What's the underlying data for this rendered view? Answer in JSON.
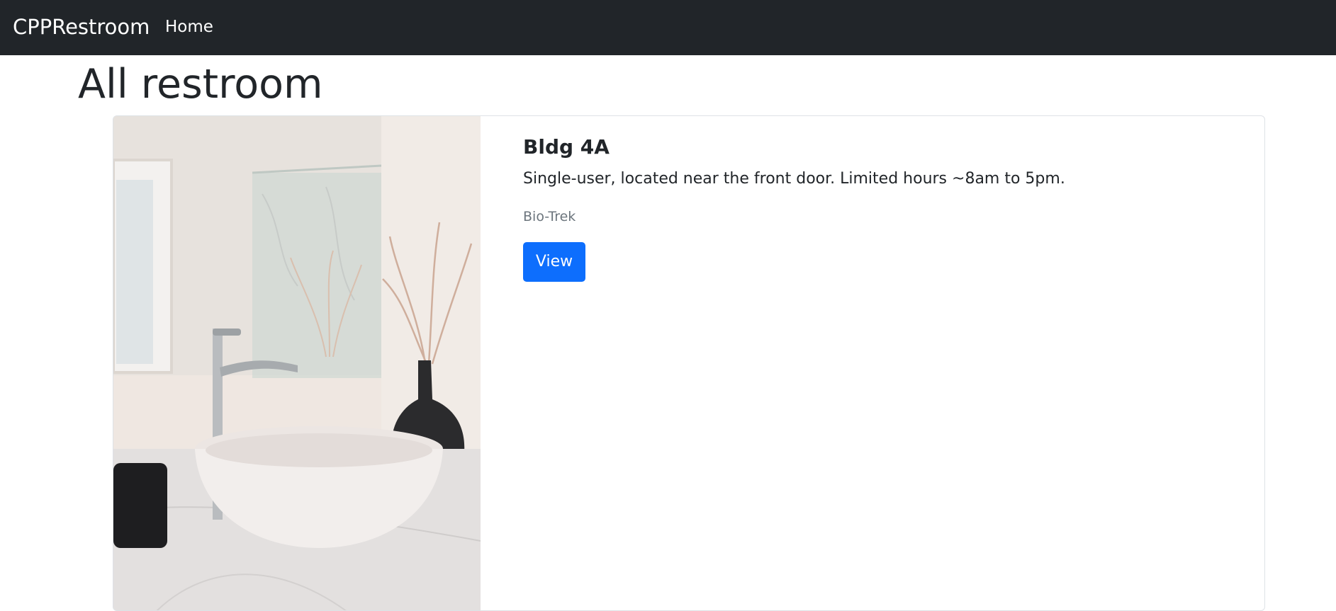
{
  "navbar": {
    "brand": "CPPRestroom",
    "home_label": "Home",
    "background_color": "#212529"
  },
  "main": {
    "title": "All restroom",
    "restrooms": [
      {
        "name": "Bldg 4A",
        "description": "Single-user, located near the front door. Limited hours ~8am to 5pm.",
        "location": "Bio-Trek",
        "button_label": "View",
        "image": "bathroom-sink-photo"
      }
    ]
  },
  "colors": {
    "primary_button": "#0d6efd",
    "muted_text": "#6c757d"
  }
}
